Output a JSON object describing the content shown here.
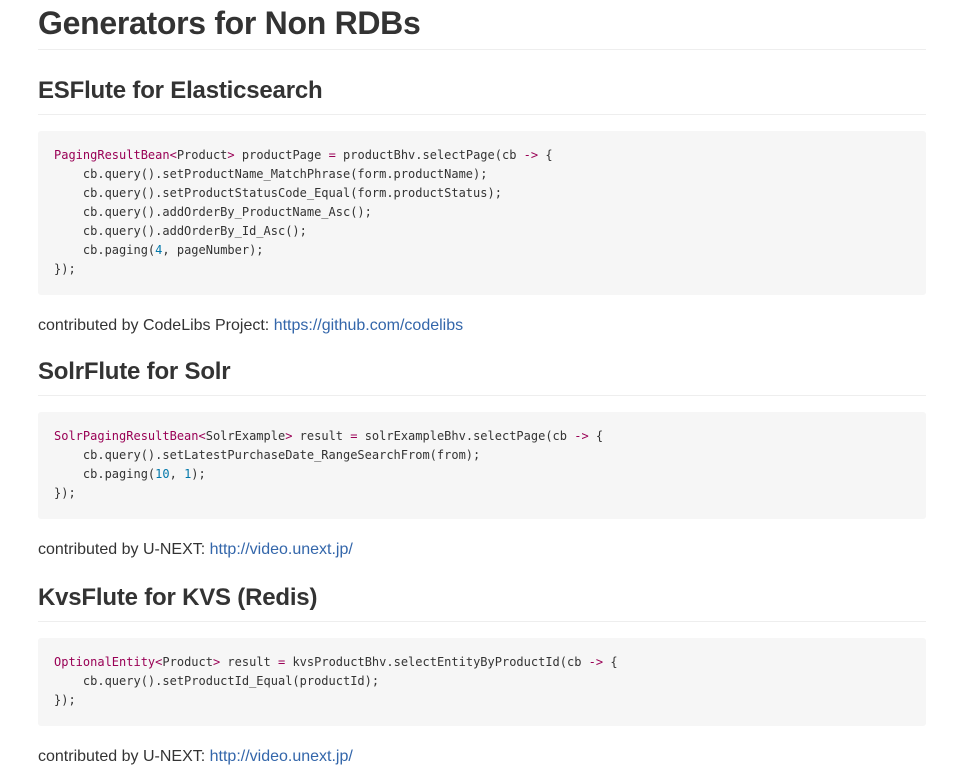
{
  "page_title": "Generators for Non RDBs",
  "sections": [
    {
      "heading": "ESFlute for Elasticsearch",
      "code": {
        "lines": [
          [
            {
              "t": "PagingResultBean",
              "c": "type"
            },
            {
              "t": "<",
              "c": "op"
            },
            {
              "t": "Product",
              "c": "plain"
            },
            {
              "t": ">",
              "c": "op"
            },
            {
              "t": " productPage ",
              "c": "plain"
            },
            {
              "t": "=",
              "c": "op"
            },
            {
              "t": " productBhv.selectPage(cb ",
              "c": "plain"
            },
            {
              "t": "->",
              "c": "op"
            },
            {
              "t": " {",
              "c": "plain"
            }
          ],
          [
            {
              "t": "    cb.query().setProductName_MatchPhrase(form.productName);",
              "c": "plain"
            }
          ],
          [
            {
              "t": "    cb.query().setProductStatusCode_Equal(form.productStatus);",
              "c": "plain"
            }
          ],
          [
            {
              "t": "    cb.query().addOrderBy_ProductName_Asc();",
              "c": "plain"
            }
          ],
          [
            {
              "t": "    cb.query().addOrderBy_Id_Asc();",
              "c": "plain"
            }
          ],
          [
            {
              "t": "    cb.paging(",
              "c": "plain"
            },
            {
              "t": "4",
              "c": "num"
            },
            {
              "t": ", pageNumber);",
              "c": "plain"
            }
          ],
          [
            {
              "t": "});",
              "c": "plain"
            }
          ]
        ]
      },
      "credit_text": "contributed by CodeLibs Project: ",
      "credit_link": "https://github.com/codelibs"
    },
    {
      "heading": "SolrFlute for Solr",
      "code": {
        "lines": [
          [
            {
              "t": "SolrPagingResultBean",
              "c": "type"
            },
            {
              "t": "<",
              "c": "op"
            },
            {
              "t": "SolrExample",
              "c": "plain"
            },
            {
              "t": ">",
              "c": "op"
            },
            {
              "t": " result ",
              "c": "plain"
            },
            {
              "t": "=",
              "c": "op"
            },
            {
              "t": " solrExampleBhv.selectPage(cb ",
              "c": "plain"
            },
            {
              "t": "->",
              "c": "op"
            },
            {
              "t": " {",
              "c": "plain"
            }
          ],
          [
            {
              "t": "    cb.query().setLatestPurchaseDate_RangeSearchFrom(from);",
              "c": "plain"
            }
          ],
          [
            {
              "t": "    cb.paging(",
              "c": "plain"
            },
            {
              "t": "10",
              "c": "num"
            },
            {
              "t": ", ",
              "c": "plain"
            },
            {
              "t": "1",
              "c": "num"
            },
            {
              "t": ");",
              "c": "plain"
            }
          ],
          [
            {
              "t": "});",
              "c": "plain"
            }
          ]
        ]
      },
      "credit_text": "contributed by U-NEXT: ",
      "credit_link": "http://video.unext.jp/"
    },
    {
      "heading": "KvsFlute for KVS (Redis)",
      "code": {
        "lines": [
          [
            {
              "t": "OptionalEntity",
              "c": "type"
            },
            {
              "t": "<",
              "c": "op"
            },
            {
              "t": "Product",
              "c": "plain"
            },
            {
              "t": ">",
              "c": "op"
            },
            {
              "t": " result ",
              "c": "plain"
            },
            {
              "t": "=",
              "c": "op"
            },
            {
              "t": " kvsProductBhv.selectEntityByProductId(cb ",
              "c": "plain"
            },
            {
              "t": "->",
              "c": "op"
            },
            {
              "t": " {",
              "c": "plain"
            }
          ],
          [
            {
              "t": "    cb.query().setProductId_Equal(productId);",
              "c": "plain"
            }
          ],
          [
            {
              "t": "});",
              "c": "plain"
            }
          ]
        ]
      },
      "credit_text": "contributed by U-NEXT: ",
      "credit_link": "http://video.unext.jp/"
    }
  ],
  "colors": {
    "text": "#333333",
    "link": "#3366aa",
    "code_background": "#f6f6f6",
    "code_type": "#990055",
    "code_number": "#0077aa"
  }
}
